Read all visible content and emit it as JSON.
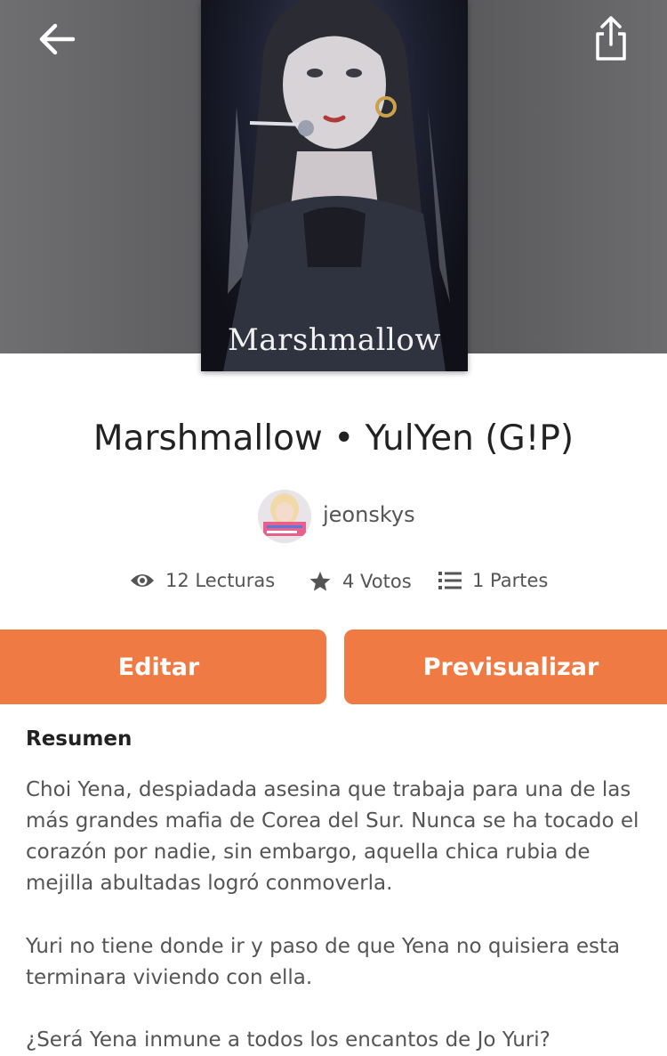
{
  "cover": {
    "title": "Marshmallow"
  },
  "story": {
    "title": "Marshmallow • YulYen (G!P)"
  },
  "author": {
    "name": "jeonskys"
  },
  "stats": {
    "reads": "12 Lecturas",
    "votes": "4 Votos",
    "parts": "1 Partes"
  },
  "buttons": {
    "edit": "Editar",
    "preview": "Previsualizar"
  },
  "summary": {
    "heading": "Resumen",
    "paragraphs": [
      "Choi Yena, despiadada asesina que trabaja para una de las más grandes mafia de Corea del Sur. Nunca se ha tocado el corazón por nadie, sin embargo, aquella chica rubia de mejilla abultadas logró conmoverla.",
      "Yuri no tiene donde ir y paso de que Yena no quisiera esta terminara viviendo con ella.",
      "¿Será Yena inmune a todos los encantos de Jo Yuri?"
    ]
  },
  "icons": {
    "back": "arrow-left-icon",
    "share": "share-icon",
    "reads": "eye-icon",
    "votes": "star-icon",
    "parts": "list-icon"
  },
  "colors": {
    "accent": "#f07a43",
    "hero_bg": "#5e5e61"
  }
}
